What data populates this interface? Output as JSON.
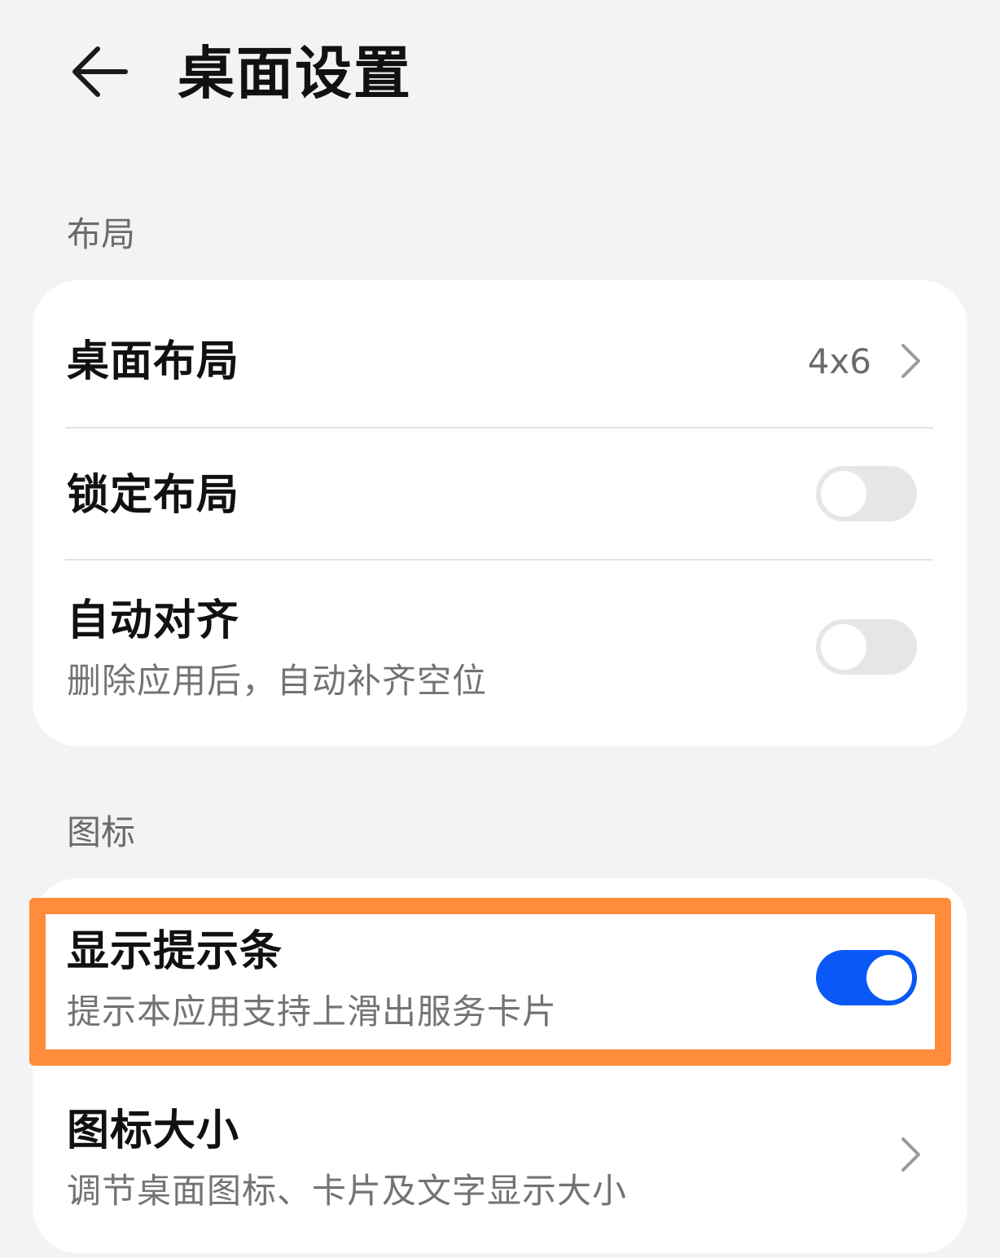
{
  "header": {
    "title": "桌面设置",
    "back_icon": "arrow-left-icon"
  },
  "sections": [
    {
      "label": "布局",
      "rows": [
        {
          "title": "桌面布局",
          "value": "4x6",
          "type": "nav"
        },
        {
          "title": "锁定布局",
          "type": "toggle",
          "checked": false
        },
        {
          "title": "自动对齐",
          "subtitle": "删除应用后，自动补齐空位",
          "type": "toggle",
          "checked": false
        }
      ]
    },
    {
      "label": "图标",
      "rows": [
        {
          "title": "显示提示条",
          "subtitle": "提示本应用支持上滑出服务卡片",
          "type": "toggle",
          "checked": true,
          "highlighted": true
        },
        {
          "title": "图标大小",
          "subtitle": "调节桌面图标、卡片及文字显示大小",
          "type": "nav"
        }
      ]
    }
  ],
  "colors": {
    "background": "#f1f3f5",
    "card": "#ffffff",
    "toggle_on": "#0a59f7",
    "toggle_off": "#e6e6e6",
    "highlight": "#ff8c3a"
  }
}
